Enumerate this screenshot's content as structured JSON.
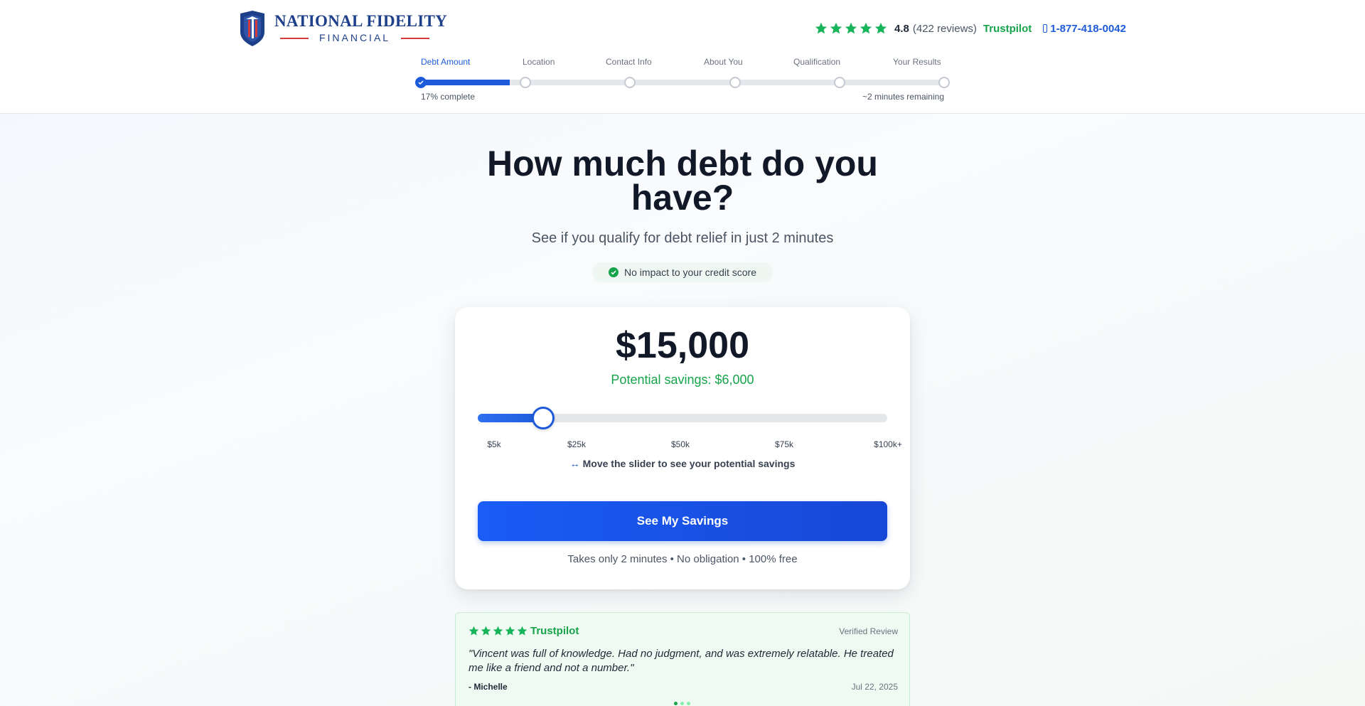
{
  "brand": {
    "name": "NATIONAL FIDELITY",
    "sub": "FINANCIAL",
    "colors": {
      "navy": "#1e3f8a",
      "red": "#d43a3a"
    }
  },
  "header": {
    "rating": "4.8",
    "reviews": "(422 reviews)",
    "trustpilot": "Trustpilot",
    "phone": "1-877-418-0042",
    "icons": [
      "star-icon",
      "phone-icon"
    ]
  },
  "progress": {
    "steps": [
      {
        "label": "Debt Amount",
        "active": true
      },
      {
        "label": "Location",
        "active": false
      },
      {
        "label": "Contact Info",
        "active": false
      },
      {
        "label": "About You",
        "active": false
      },
      {
        "label": "Qualification",
        "active": false
      },
      {
        "label": "Your Results",
        "active": false
      }
    ],
    "percent": 17,
    "complete_text": "17% complete",
    "remaining_text": "~2 minutes remaining",
    "color": "#1d5bd8"
  },
  "hero": {
    "title": "How much debt do you have?",
    "subtitle": "See if you qualify for debt relief in just 2 minutes",
    "badge": "No impact to your credit score"
  },
  "calculator": {
    "amount": "$15,000",
    "savings": "Potential savings: $6,000",
    "slider_fraction": 0.16,
    "ticks": [
      "$5k",
      "$25k",
      "$50k",
      "$75k",
      "$100k+"
    ],
    "hint": "Move the slider to see your potential savings",
    "cta": "See My Savings",
    "fine_print": "Takes only 2 minutes • No obligation • 100% free"
  },
  "review": {
    "source": "Trustpilot",
    "verified": "Verified Review",
    "quote": "\"Vincent was full of knowledge. Had no judgment, and was extremely relatable. He treated me like a friend and not a number.\"",
    "author": "- Michelle",
    "date": "Jul 22, 2025",
    "active_dot": 0
  }
}
